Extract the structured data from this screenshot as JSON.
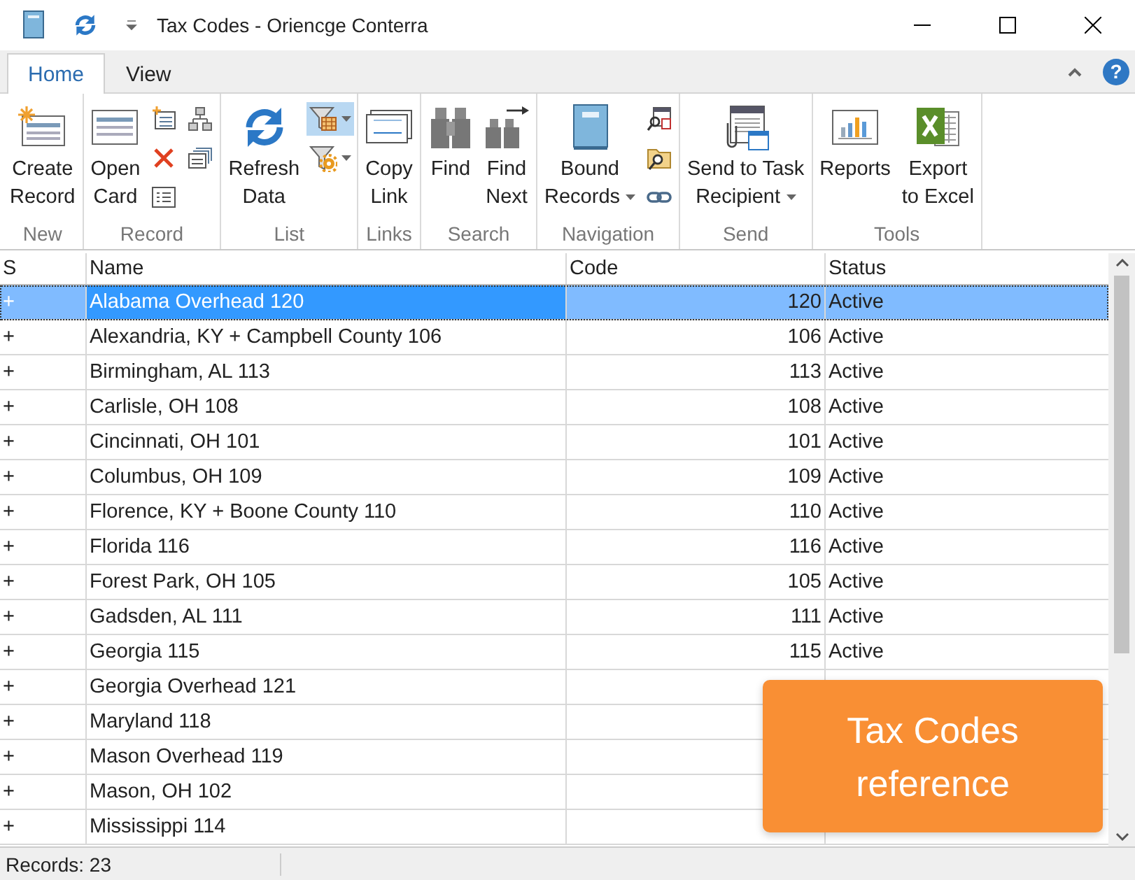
{
  "window": {
    "title": "Tax Codes - Oriencge Conterra"
  },
  "ribbon_tabs": [
    {
      "label": "Home",
      "selected": true
    },
    {
      "label": "View",
      "selected": false
    }
  ],
  "help": {
    "label": "?"
  },
  "ribbon_groups": [
    {
      "label": "New",
      "items": [
        {
          "kind": "large",
          "lines": [
            "Create",
            "Record"
          ],
          "has_menu": false
        }
      ]
    },
    {
      "label": "Record",
      "items": [
        {
          "kind": "large",
          "lines": [
            "Open",
            "Card"
          ],
          "has_menu": false
        },
        {
          "kind": "small_column",
          "items": [
            {
              "has_menu": false,
              "on": false
            },
            {
              "has_menu": false,
              "on": false
            },
            {
              "has_menu": false,
              "on": false
            }
          ]
        },
        {
          "kind": "small_column",
          "items": [
            {
              "has_menu": false,
              "on": false
            },
            {
              "has_menu": false,
              "on": false
            }
          ]
        }
      ]
    },
    {
      "label": "List",
      "items": [
        {
          "kind": "large",
          "lines": [
            "Refresh",
            "Data"
          ],
          "has_menu": false
        },
        {
          "kind": "small_column",
          "items": [
            {
              "has_menu": true,
              "on": true
            },
            {
              "has_menu": true,
              "on": false
            }
          ]
        }
      ]
    },
    {
      "label": "Links",
      "items": [
        {
          "kind": "large",
          "lines": [
            "Copy",
            "Link"
          ],
          "has_menu": false
        }
      ]
    },
    {
      "label": "Search",
      "items": [
        {
          "kind": "large",
          "lines": [
            "Find"
          ],
          "has_menu": false
        },
        {
          "kind": "large",
          "lines": [
            "Find",
            "Next"
          ],
          "has_menu": false
        }
      ]
    },
    {
      "label": "Navigation",
      "items": [
        {
          "kind": "large",
          "lines": [
            "Bound",
            "Records"
          ],
          "has_menu": true
        },
        {
          "kind": "small_column",
          "items": [
            {
              "has_menu": false,
              "on": false
            },
            {
              "has_menu": false,
              "on": false
            },
            {
              "has_menu": false,
              "on": false
            }
          ]
        }
      ]
    },
    {
      "label": "Send",
      "items": [
        {
          "kind": "large",
          "lines": [
            "Send to Task",
            "Recipient"
          ],
          "has_menu": true
        }
      ]
    },
    {
      "label": "Tools",
      "items": [
        {
          "kind": "large",
          "lines": [
            "Reports"
          ],
          "has_menu": false
        },
        {
          "kind": "large",
          "lines": [
            "Export",
            "to Excel"
          ],
          "has_menu": false
        }
      ]
    }
  ],
  "table": {
    "columns": [
      "S",
      "Name",
      "Code",
      "Status"
    ],
    "rows": [
      {
        "s": "+",
        "name": "Alabama Overhead 120",
        "code": "120",
        "status": "Active",
        "selected": true
      },
      {
        "s": "+",
        "name": "Alexandria, KY + Campbell County 106",
        "code": "106",
        "status": "Active",
        "selected": false
      },
      {
        "s": "+",
        "name": "Birmingham, AL 113",
        "code": "113",
        "status": "Active",
        "selected": false
      },
      {
        "s": "+",
        "name": "Carlisle, OH 108",
        "code": "108",
        "status": "Active",
        "selected": false
      },
      {
        "s": "+",
        "name": "Cincinnati, OH 101",
        "code": "101",
        "status": "Active",
        "selected": false
      },
      {
        "s": "+",
        "name": "Columbus, OH 109",
        "code": "109",
        "status": "Active",
        "selected": false
      },
      {
        "s": "+",
        "name": "Florence, KY + Boone County 110",
        "code": "110",
        "status": "Active",
        "selected": false
      },
      {
        "s": "+",
        "name": "Florida 116",
        "code": "116",
        "status": "Active",
        "selected": false
      },
      {
        "s": "+",
        "name": "Forest Park, OH 105",
        "code": "105",
        "status": "Active",
        "selected": false
      },
      {
        "s": "+",
        "name": "Gadsden, AL 111",
        "code": "111",
        "status": "Active",
        "selected": false
      },
      {
        "s": "+",
        "name": "Georgia 115",
        "code": "115",
        "status": "Active",
        "selected": false
      },
      {
        "s": "+",
        "name": "Georgia Overhead 121",
        "selected": false
      },
      {
        "s": "+",
        "name": "Maryland 118",
        "selected": false
      },
      {
        "s": "+",
        "name": "Mason Overhead 119",
        "selected": false
      },
      {
        "s": "+",
        "name": "Mason, OH 102",
        "selected": false
      },
      {
        "s": "+",
        "name": "Mississippi 114",
        "selected": false
      }
    ]
  },
  "status_bar": {
    "text": "Records: 23"
  },
  "callout": {
    "text": "Tax Codes reference"
  }
}
